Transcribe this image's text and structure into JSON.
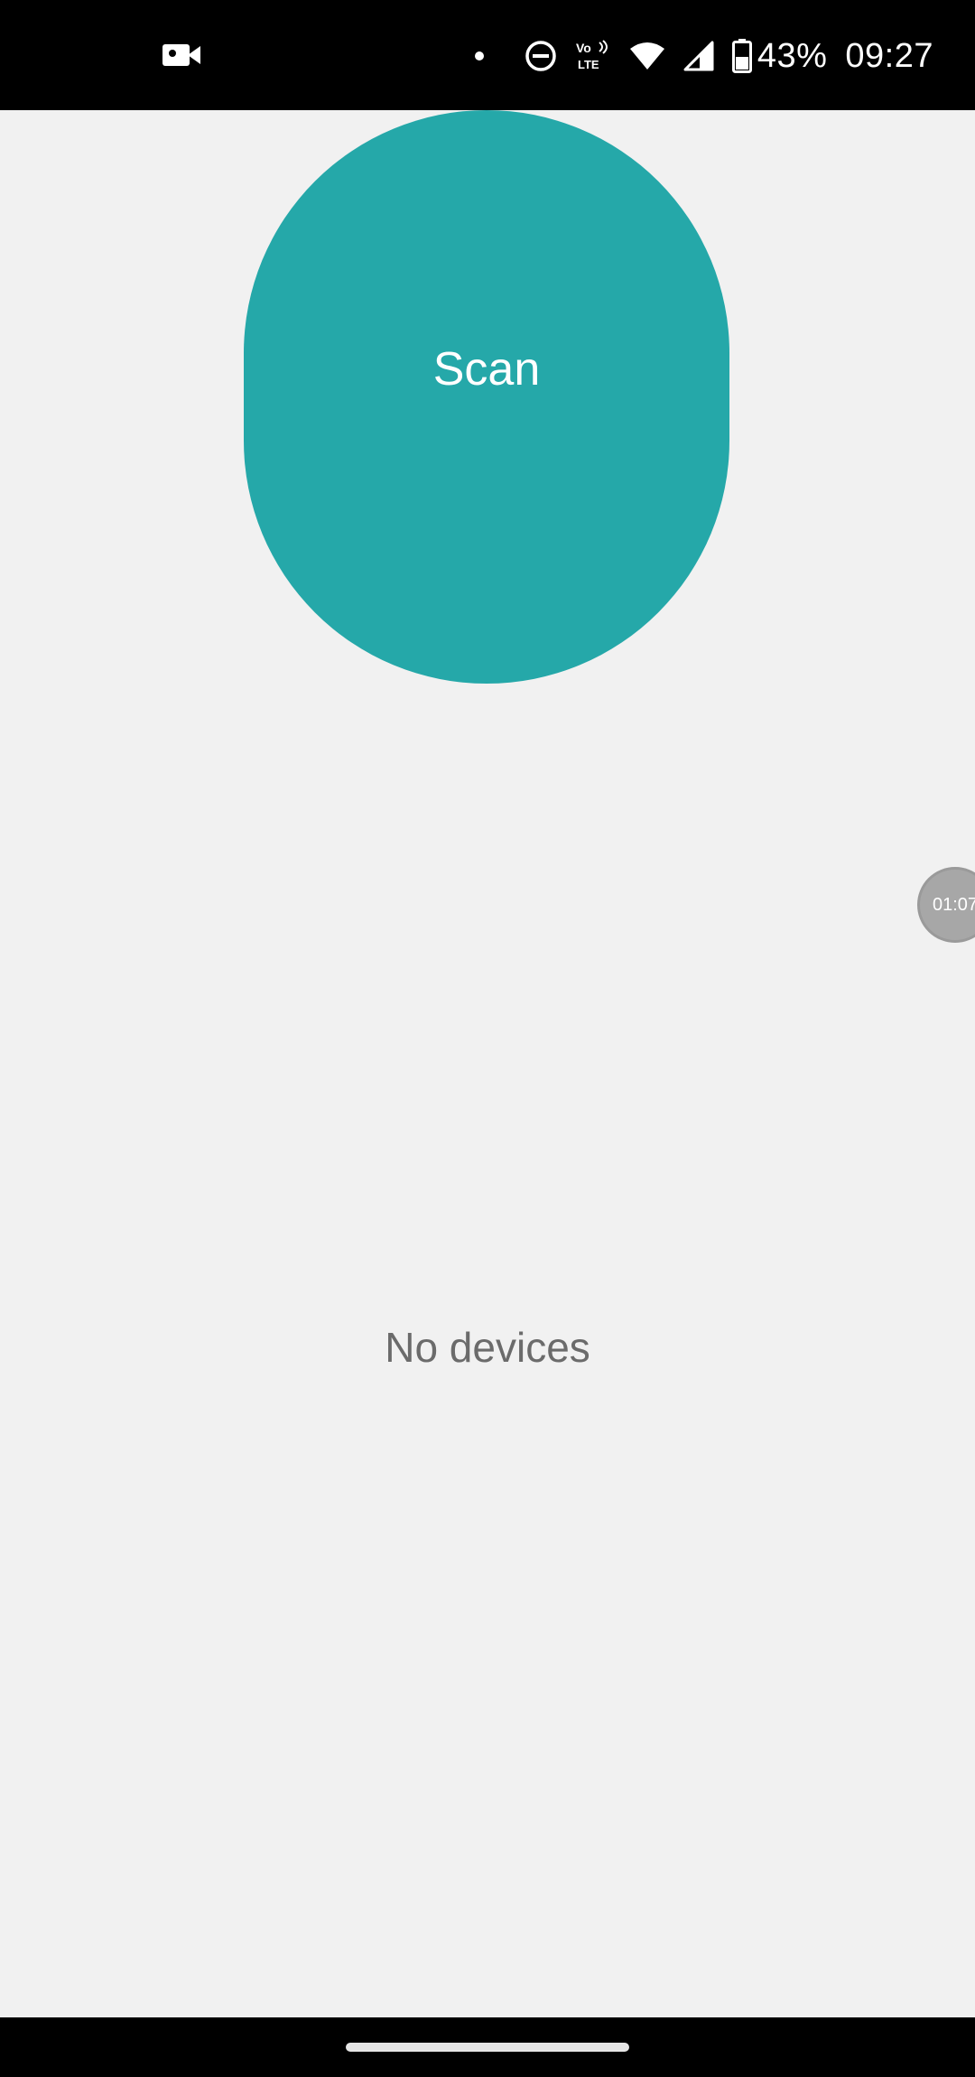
{
  "status_bar": {
    "battery": "43%",
    "time": "09:27",
    "icons": [
      "video-camera-icon",
      "notification-dot-icon",
      "do-not-disturb-icon",
      "volte-icon",
      "wifi-icon",
      "signal-icon",
      "battery-icon"
    ]
  },
  "main": {
    "scan_label": "Scan",
    "empty_state": "No devices"
  },
  "overlay": {
    "recording_timer": "01:07"
  },
  "colors": {
    "accent": "#25a8a9",
    "background": "#f1f1f1",
    "empty_text": "#6b6b6b"
  }
}
